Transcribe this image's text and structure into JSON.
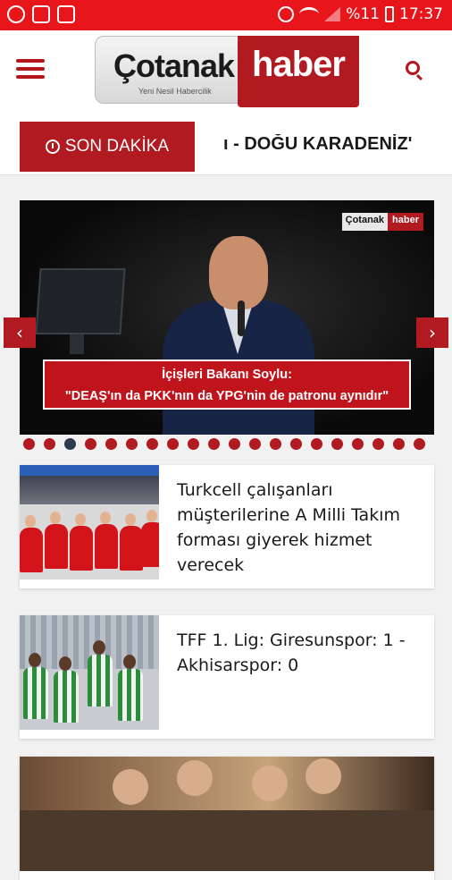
{
  "status_bar": {
    "battery": "%11",
    "time": "17:37",
    "left_icons": [
      "notification-icon",
      "gallery-icon",
      "image-icon"
    ]
  },
  "header": {
    "logo_word": "Çotanak",
    "logo_tagline": "Yeni Nesil Habercilik",
    "logo_haber": "haber"
  },
  "ticker": {
    "label": "SON DAKİKA",
    "text": "ı - DOĞU KARADENİZ'"
  },
  "slider": {
    "watermark_left": "Çotanak",
    "watermark_right": "haber",
    "caption_line1": "İçişleri Bakanı Soylu:",
    "caption_line2": "\"DEAŞ'ın da PKK'nın da YPG'nin de patronu aynıdır\"",
    "prev": "‹",
    "next": "›",
    "dots_total": 20,
    "active_dot": 3
  },
  "news": [
    {
      "title": "Turkcell çalışanları müşterilerine A Milli Takım forması giyerek hizmet verecek"
    },
    {
      "title": "TFF 1. Lig: Giresunspor: 1 - Akhisarspor: 0"
    },
    {
      "title": ""
    }
  ],
  "colors": {
    "status_bar": "#e8151b",
    "brand_red": "#b01a20",
    "active_dot": "#2d3a4e"
  }
}
